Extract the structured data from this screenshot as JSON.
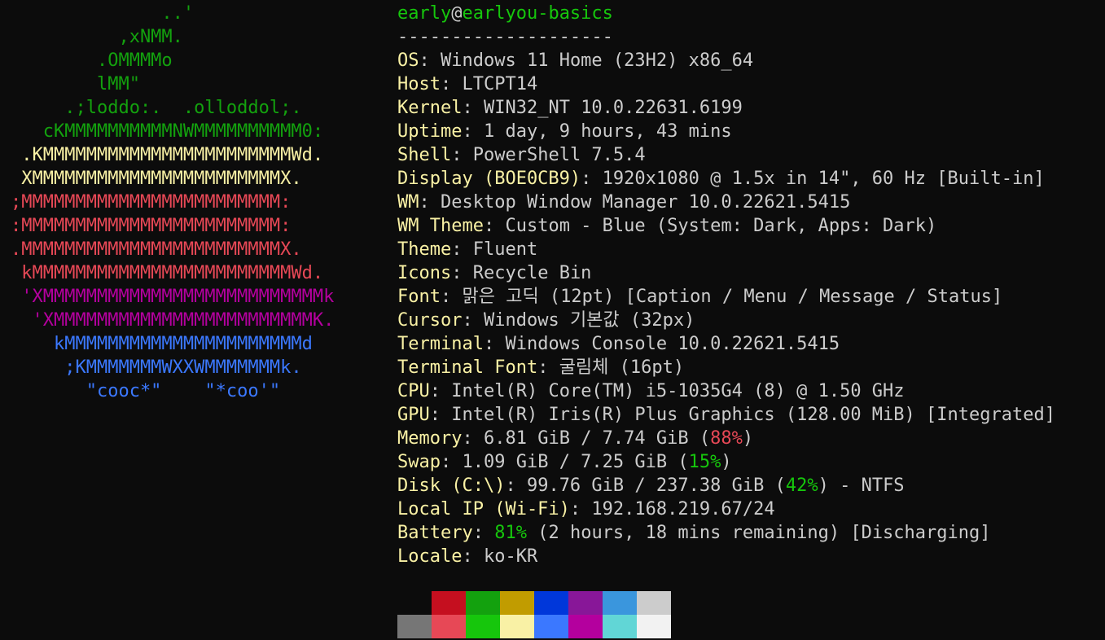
{
  "logo": {
    "lines": [
      {
        "text": "              ..'",
        "color": "green"
      },
      {
        "text": "          ,xNMM.",
        "color": "green"
      },
      {
        "text": "        .OMMMMo",
        "color": "green"
      },
      {
        "text": "        lMM\"",
        "color": "green"
      },
      {
        "text": "     .;loddo:.  .olloddol;.",
        "color": "green"
      },
      {
        "text": "   cKMMMMMMMMMMNWMMMMMMMMMM0:",
        "color": "green"
      },
      {
        "text": " .KMMMMMMMMMMMMMMMMMMMMMMMWd.",
        "color": "yellow"
      },
      {
        "text": " XMMMMMMMMMMMMMMMMMMMMMMMX.",
        "color": "yellow"
      },
      {
        "text": ";MMMMMMMMMMMMMMMMMMMMMMMM:",
        "color": "red"
      },
      {
        "text": ":MMMMMMMMMMMMMMMMMMMMMMMM:",
        "color": "red"
      },
      {
        "text": ".MMMMMMMMMMMMMMMMMMMMMMMMX.",
        "color": "red"
      },
      {
        "text": " kMMMMMMMMMMMMMMMMMMMMMMMMWd.",
        "color": "red"
      },
      {
        "text": " 'XMMMMMMMMMMMMMMMMMMMMMMMMMMk",
        "color": "purple"
      },
      {
        "text": "  'XMMMMMMMMMMMMMMMMMMMMMMMMK.",
        "color": "purple"
      },
      {
        "text": "    kMMMMMMMMMMMMMMMMMMMMMMd",
        "color": "blue"
      },
      {
        "text": "     ;KMMMMMMMWXXWMMMMMMMk.",
        "color": "blue"
      },
      {
        "text": "       \"cooc*\"    \"*coo'\"",
        "color": "blue"
      }
    ]
  },
  "title": {
    "user": "early",
    "at": "@",
    "host": "earlyou-basics"
  },
  "separator": "--------------------",
  "rows": {
    "os": {
      "key": "OS",
      "value": "Windows 11 Home (23H2) x86_64"
    },
    "host": {
      "key": "Host",
      "value": "LTCPT14"
    },
    "kernel": {
      "key": "Kernel",
      "value": "WIN32_NT 10.0.22631.6199"
    },
    "uptime": {
      "key": "Uptime",
      "value": "1 day, 9 hours, 43 mins"
    },
    "shell": {
      "key": "Shell",
      "value": "PowerShell 7.5.4"
    },
    "display": {
      "key": "Display (BOE0CB9)",
      "value": "1920x1080 @ 1.5x in 14\", 60 Hz [Built-in]"
    },
    "wm": {
      "key": "WM",
      "value": "Desktop Window Manager 10.0.22621.5415"
    },
    "wm_theme": {
      "key": "WM Theme",
      "value": "Custom - Blue (System: Dark, Apps: Dark)"
    },
    "theme": {
      "key": "Theme",
      "value": "Fluent"
    },
    "icons": {
      "key": "Icons",
      "value": "Recycle Bin"
    },
    "font": {
      "key": "Font",
      "value": "맑은 고딕 (12pt) [Caption / Menu / Message / Status]"
    },
    "cursor": {
      "key": "Cursor",
      "value": "Windows 기본값 (32px)"
    },
    "terminal": {
      "key": "Terminal",
      "value": "Windows Console 10.0.22621.5415"
    },
    "terminal_font": {
      "key": "Terminal Font",
      "value": "굴림체 (16pt)"
    },
    "cpu": {
      "key": "CPU",
      "value": "Intel(R) Core(TM) i5-1035G4 (8) @ 1.50 GHz"
    },
    "gpu": {
      "key": "GPU",
      "value": "Intel(R) Iris(R) Plus Graphics (128.00 MiB) [Integrated]"
    },
    "memory": {
      "key": "Memory",
      "pre": "6.81 GiB / 7.74 GiB (",
      "pct": "88%",
      "post": ")"
    },
    "swap": {
      "key": "Swap",
      "pre": "1.09 GiB / 7.25 GiB (",
      "pct": "15%",
      "post": ")"
    },
    "disk": {
      "key": "Disk (C:\\)",
      "pre": "99.76 GiB / 237.38 GiB (",
      "pct": "42%",
      "post": ") - NTFS"
    },
    "local_ip": {
      "key": "Local IP (Wi-Fi)",
      "value": "192.168.219.67/24"
    },
    "battery": {
      "key": "Battery",
      "pct": "81%",
      "post": " (2 hours, 18 mins remaining) [Discharging]"
    },
    "locale": {
      "key": "Locale",
      "value": "ko-KR"
    }
  },
  "colors": {
    "green": "#13a10e",
    "yellow": "#f9f1a5",
    "red": "#e74856",
    "purple": "#b4009e",
    "blue": "#3b78ff",
    "key": "#f9f1a5",
    "text": "#cccccc"
  },
  "palette": {
    "dark": [
      "#0c0c0c",
      "#c50f1f",
      "#13a10e",
      "#c19c00",
      "#0037da",
      "#881798",
      "#3a96dd",
      "#cccccc"
    ],
    "bright": [
      "#767676",
      "#e74856",
      "#16c60c",
      "#f9f1a5",
      "#3b78ff",
      "#b4009e",
      "#61d6d6",
      "#f2f2f2"
    ]
  }
}
